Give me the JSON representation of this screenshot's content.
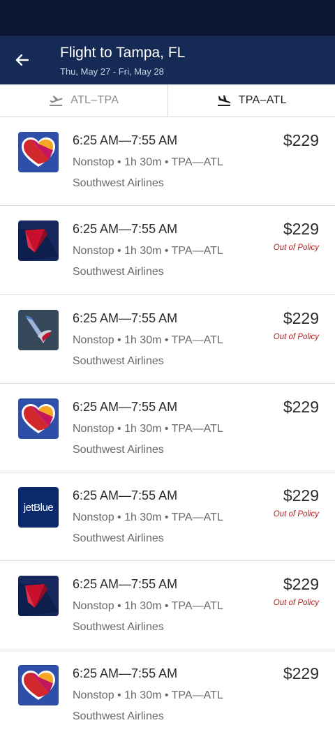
{
  "header": {
    "title": "Flight to Tampa, FL",
    "subtitle": "Thu, May 27 - Fri, May 28"
  },
  "tabs": [
    {
      "label": "ATL–TPA",
      "icon": "takeoff-icon",
      "active": false
    },
    {
      "label": "TPA–ATL",
      "icon": "landing-icon",
      "active": true
    }
  ],
  "flights": [
    {
      "logo": "southwest",
      "time": "6:25 AM—7:55 AM",
      "details": "Nonstop • 1h 30m • TPA—ATL",
      "airline": "Southwest Airlines",
      "price": "$229",
      "policy": ""
    },
    {
      "logo": "delta",
      "time": "6:25 AM—7:55 AM",
      "details": "Nonstop • 1h 30m • TPA—ATL",
      "airline": "Southwest Airlines",
      "price": "$229",
      "policy": "Out of Policy"
    },
    {
      "logo": "american",
      "time": "6:25 AM—7:55 AM",
      "details": "Nonstop • 1h 30m • TPA—ATL",
      "airline": "Southwest Airlines",
      "price": "$229",
      "policy": "Out of Policy"
    },
    {
      "logo": "southwest",
      "time": "6:25 AM—7:55 AM",
      "details": "Nonstop • 1h 30m • TPA—ATL",
      "airline": "Southwest Airlines",
      "price": "$229",
      "policy": ""
    },
    {
      "logo": "jetblue",
      "logo_text": "jetBlue",
      "time": "6:25 AM—7:55 AM",
      "details": "Nonstop • 1h 30m • TPA—ATL",
      "airline": "Southwest Airlines",
      "price": "$229",
      "policy": "Out of Policy"
    },
    {
      "logo": "delta",
      "time": "6:25 AM—7:55 AM",
      "details": "Nonstop • 1h 30m • TPA—ATL",
      "airline": "Southwest Airlines",
      "price": "$229",
      "policy": "Out of Policy"
    },
    {
      "logo": "southwest",
      "time": "6:25 AM—7:55 AM",
      "details": "Nonstop • 1h 30m • TPA—ATL",
      "airline": "Southwest Airlines",
      "price": "$229",
      "policy": ""
    }
  ],
  "colors": {
    "status_bar": "#0b1730",
    "header": "#152a54",
    "policy_red": "#b02323"
  }
}
